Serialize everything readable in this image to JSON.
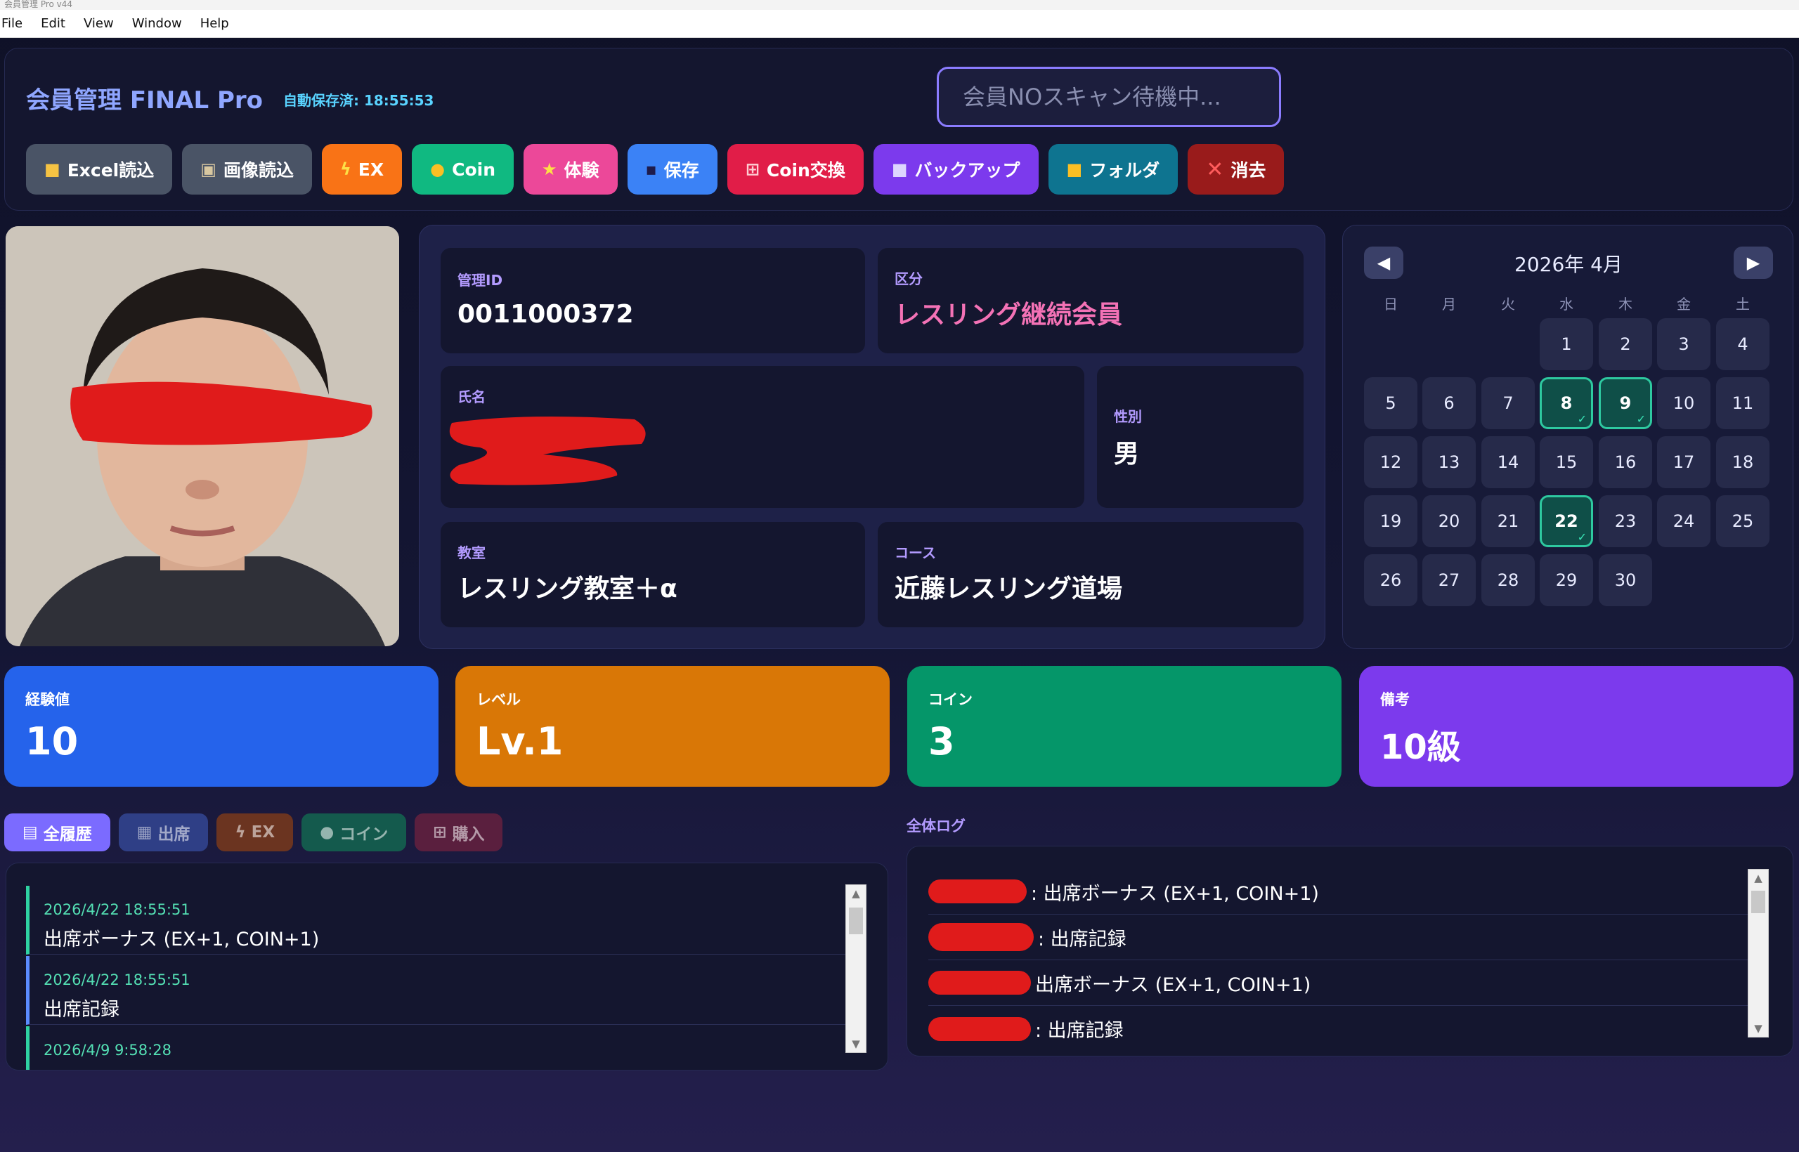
{
  "window": {
    "title": "会員管理 Pro v44"
  },
  "menu": {
    "file": "File",
    "edit": "Edit",
    "view": "View",
    "window": "Window",
    "help": "Help"
  },
  "header": {
    "title": "会員管理 FINAL Pro",
    "autosave": "自動保存済: 18:55:53",
    "scan_placeholder": "会員NOスキャン待機中..."
  },
  "toolbar": {
    "excel": "Excel読込",
    "image": "画像読込",
    "ex": "EX",
    "coin": "Coin",
    "trial": "体験",
    "save": "保存",
    "coin_exchange": "Coin交換",
    "backup": "バックアップ",
    "folder": "フォルダ",
    "delete": "消去"
  },
  "colors": {
    "excel": "#4a5466",
    "image": "#4a5466",
    "ex": "#f97316",
    "coin": "#10b981",
    "trial": "#ec4899",
    "save": "#3b82f6",
    "coin_exchange": "#e11d48",
    "backup": "#7c3aed",
    "folder": "#0e7490",
    "delete": "#991b1b",
    "stat_exp": "#2563eb",
    "stat_level": "#d97706",
    "stat_coin": "#059669",
    "stat_note": "#7c3aed"
  },
  "member": {
    "id_label": "管理ID",
    "id": "0011000372",
    "category_label": "区分",
    "category": "レスリング継続会員",
    "name_label": "氏名",
    "gender_label": "性別",
    "gender": "男",
    "classroom_label": "教室",
    "classroom": "レスリング教室＋α",
    "course_label": "コース",
    "course": "近藤レスリング道場"
  },
  "calendar": {
    "month": "2026年 4月",
    "weekdays": [
      "日",
      "月",
      "火",
      "水",
      "木",
      "金",
      "土"
    ],
    "days": [
      "1",
      "2",
      "3",
      "4",
      "5",
      "6",
      "7",
      "8",
      "9",
      "10",
      "11",
      "12",
      "13",
      "14",
      "15",
      "16",
      "17",
      "18",
      "19",
      "20",
      "21",
      "22",
      "23",
      "24",
      "25",
      "26",
      "27",
      "28",
      "29",
      "30"
    ],
    "check_mark": "✓"
  },
  "stats": {
    "exp_label": "経験値",
    "exp": "10",
    "level_label": "レベル",
    "level": "Lv.1",
    "coin_label": "コイン",
    "coin": "3",
    "note_label": "備考",
    "note": "10級"
  },
  "history_tabs": {
    "all": "全履歴",
    "attendance": "出席",
    "ex": "EX",
    "coin": "コイン",
    "purchase": "購入"
  },
  "history": [
    {
      "time": "2026/4/22 18:55:51",
      "text": "出席ボーナス (EX+1, COIN+1)"
    },
    {
      "time": "2026/4/22 18:55:51",
      "text": "出席記録"
    },
    {
      "time": "2026/4/9 9:58:28",
      "text": ""
    }
  ],
  "log": {
    "title": "全体ログ",
    "entries": [
      {
        "text": ": 出席ボーナス (EX+1, COIN+1)"
      },
      {
        "text": ": 出席記録"
      },
      {
        "text": "出席ボーナス (EX+1, COIN+1)"
      },
      {
        "text": ": 出席記録"
      }
    ]
  }
}
